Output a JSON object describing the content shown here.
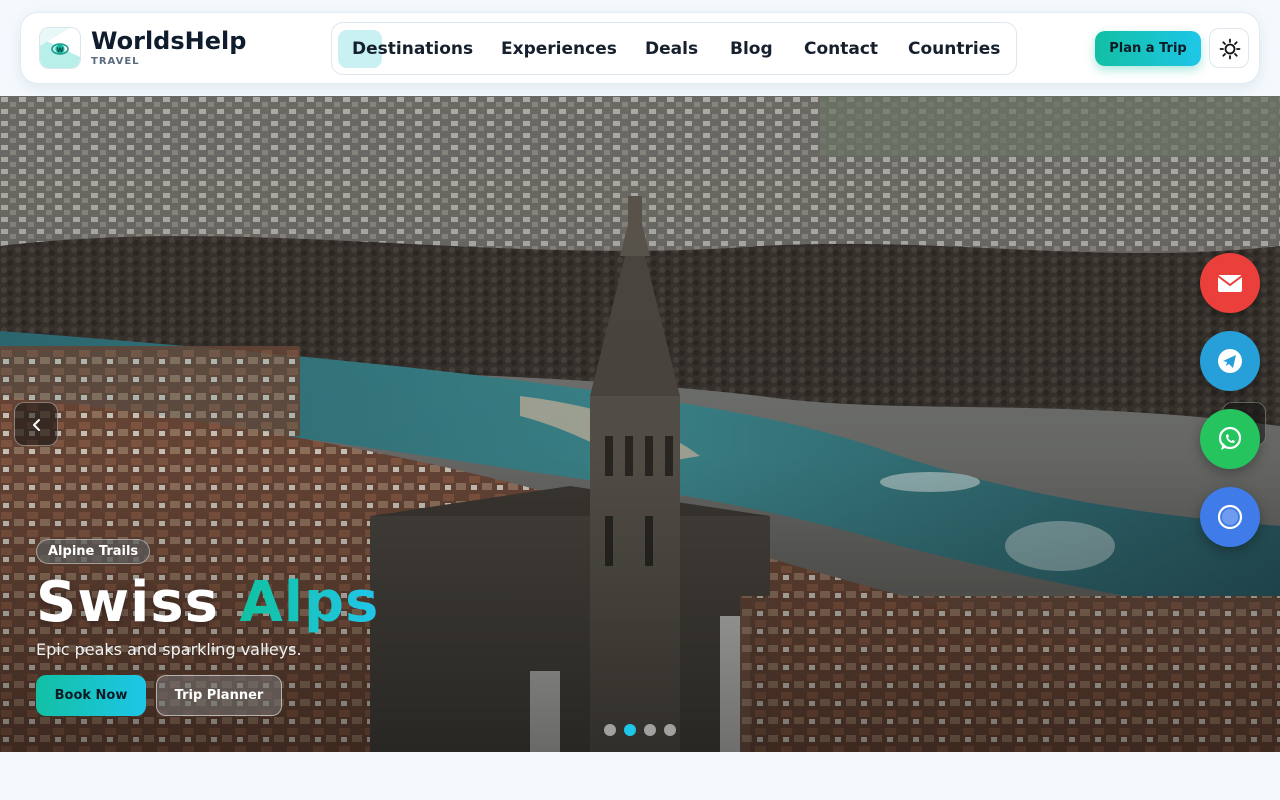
{
  "brand": {
    "name": "WorldsHelp",
    "sub": "TRAVEL",
    "logo_icon": "globe-logo-icon"
  },
  "nav": {
    "items": [
      {
        "label": "Destinations",
        "active": true
      },
      {
        "label": "Experiences"
      },
      {
        "label": "Deals"
      },
      {
        "label": "Blog"
      },
      {
        "label": "Contact"
      },
      {
        "label": "Countries"
      }
    ]
  },
  "header": {
    "plan_label": "Plan a Trip",
    "theme_icon": "sun-icon"
  },
  "hero": {
    "tag": "Alpine Trails",
    "title_main": "Swiss",
    "title_accent": "Alps",
    "subtitle": "Epic peaks and sparkling valleys.",
    "book_label": "Book Now",
    "planner_label": "Trip Planner",
    "slide_count": 4,
    "active_slide": 2
  },
  "floating_contacts": [
    {
      "icon": "mail-icon",
      "color": "#ea3f3b"
    },
    {
      "icon": "telegram-icon",
      "color": "#279fd9"
    },
    {
      "icon": "whatsapp-icon",
      "color": "#25c45f"
    },
    {
      "icon": "chat-icon",
      "color": "#3f7be9"
    }
  ],
  "colors": {
    "accent_start": "#12c0a4",
    "accent_end": "#1ec6e8",
    "nav_highlight": "#c9f1f1",
    "text_dark": "#16202c",
    "page_bg": "#f3f9fd"
  }
}
